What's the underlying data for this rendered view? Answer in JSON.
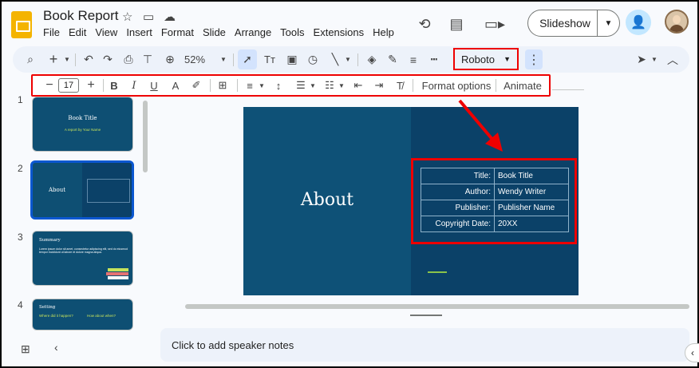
{
  "doc": {
    "title": "Book Report"
  },
  "menu": [
    "File",
    "Edit",
    "View",
    "Insert",
    "Format",
    "Slide",
    "Arrange",
    "Tools",
    "Extensions",
    "Help"
  ],
  "header": {
    "slideshow_label": "Slideshow"
  },
  "toolbar": {
    "zoom": "52%",
    "font": "Roboto"
  },
  "format_bar": {
    "font_size": "17",
    "format_options": "Format options",
    "animate": "Animate"
  },
  "slides": [
    {
      "num": "1",
      "title": "Book Title",
      "subtitle": "A report by Your Name"
    },
    {
      "num": "2",
      "title": "About"
    },
    {
      "num": "3",
      "title": "Summary",
      "body": "Lorem ipsum dolor sit amet, consectetur adipiscing elit, sed do eiusmod tempor incididunt ut labore et dolore magna aliqua."
    },
    {
      "num": "4",
      "title": "Setting",
      "left_head": "Where did it happen?",
      "right_head": "How about when?"
    }
  ],
  "current_slide": {
    "heading": "About",
    "table": [
      {
        "label": "Title:",
        "value": "Book Title"
      },
      {
        "label": "Author:",
        "value": "Wendy Writer"
      },
      {
        "label": "Publisher:",
        "value": "Publisher Name"
      },
      {
        "label": "Copyright Date:",
        "value": "20XX"
      }
    ]
  },
  "notes": {
    "placeholder": "Click to add speaker notes"
  },
  "colors": {
    "slide_bg": "#0e5177",
    "slide_panel": "#0b4168",
    "highlight": "#e00000",
    "accent": "#8bc34a"
  }
}
